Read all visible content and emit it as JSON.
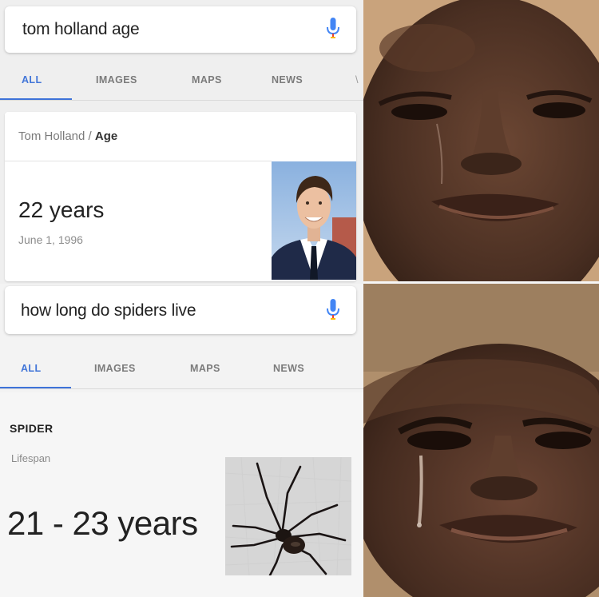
{
  "panel1": {
    "search": {
      "query": "tom holland age"
    },
    "tabs": [
      {
        "label": "ALL",
        "active": true
      },
      {
        "label": "IMAGES",
        "active": false
      },
      {
        "label": "MAPS",
        "active": false
      },
      {
        "label": "NEWS",
        "active": false
      }
    ],
    "result": {
      "breadcrumb_entity": "Tom Holland",
      "breadcrumb_sep": " / ",
      "breadcrumb_attr": "Age",
      "value": "22 years",
      "subtext": "June 1, 1996"
    }
  },
  "panel2": {
    "search": {
      "query": "how long do spiders live"
    },
    "tabs": [
      {
        "label": "ALL",
        "active": true
      },
      {
        "label": "IMAGES",
        "active": false
      },
      {
        "label": "MAPS",
        "active": false
      },
      {
        "label": "NEWS",
        "active": false
      }
    ],
    "result": {
      "title": "SPIDER",
      "label": "Lifespan",
      "value": "21 - 23 years"
    }
  },
  "icons": {
    "mic": "microphone-icon",
    "photo": "portrait-photo",
    "spider": "spider-photo"
  },
  "colors": {
    "accent": "#4175d8",
    "mic_blue": "#4285f4",
    "mic_red": "#ea4335",
    "mic_yellow": "#fbbc05"
  }
}
